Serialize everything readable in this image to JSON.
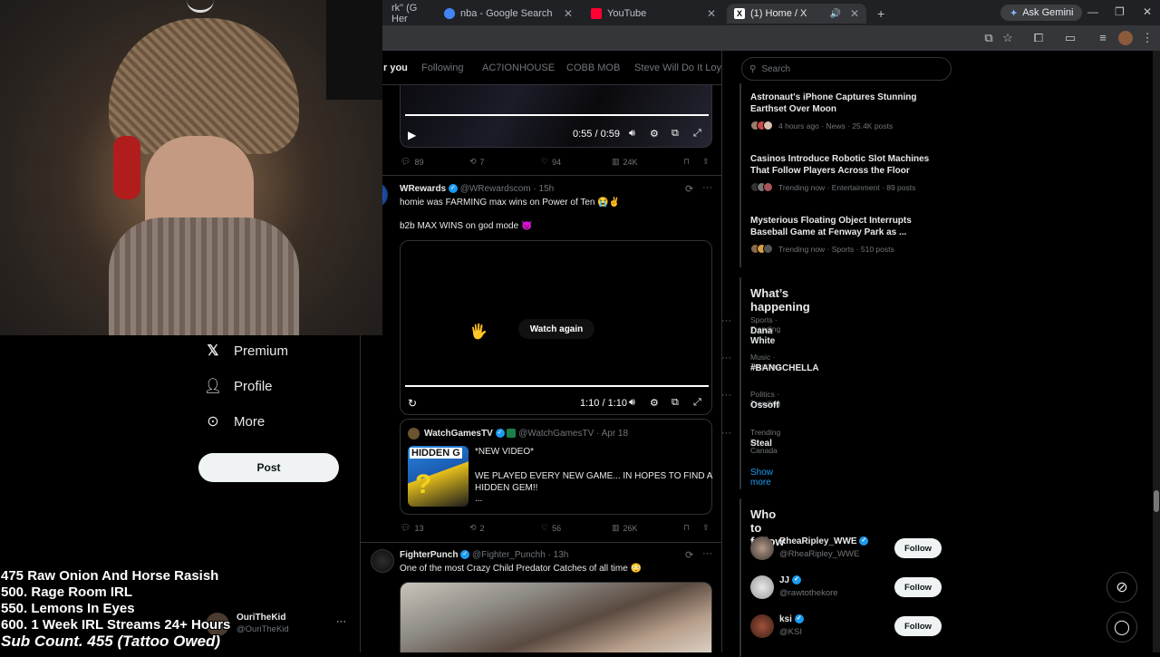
{
  "browser": {
    "tabs": [
      {
        "label": "rk\" (G Her",
        "favicon_color": "#5f6368"
      },
      {
        "label": "nba - Google Search",
        "favicon_color": "#4285f4"
      },
      {
        "label": "YouTube",
        "favicon_color": "#ff0033"
      },
      {
        "label": "(1) Home / X",
        "favicon_color": "#000000"
      }
    ],
    "new_tab": "+",
    "ask_gemini": "Ask Gemini"
  },
  "feed_tabs": [
    "r you",
    "Following",
    "AC7IONHOUSE",
    "COBB MOB",
    "Steve Will Do It Loyal"
  ],
  "nav": {
    "premium": "Premium",
    "profile": "Profile",
    "more": "More",
    "post": "Post"
  },
  "account": {
    "name": "OuriTheKid",
    "handle": "@OuriTheKid"
  },
  "stream_overlay": [
    "475 Raw Onion And Horse Rasish",
    "500. Rage Room IRL",
    "550. Lemons In Eyes",
    "600. 1 Week IRL Streams 24+ Hours",
    "Sub Count. 455 (Tattoo Owed)"
  ],
  "tweet1": {
    "video_time": "0:55 / 0:59",
    "replies": "89",
    "reposts": "7",
    "likes": "94",
    "views": "24K"
  },
  "tweet2": {
    "name": "WRewards",
    "handle": "@WRewardscom",
    "time": "· 15h",
    "line1": "homie was FARMING max wins on Power of Ten 😭✌️",
    "line2": "b2b MAX WINS on god mode 😈",
    "watch_again": "Watch again",
    "video_time": "1:10 / 1:10",
    "quote": {
      "name": "WatchGamesTV",
      "handle": "@WatchGamesTV",
      "time": "· Apr 18",
      "thumb_text": "HIDDEN G",
      "line1": "*NEW VIDEO*",
      "line2": "WE PLAYED EVERY NEW GAME... IN HOPES TO FIND A",
      "line3": "HIDDEN GEM!!",
      "line4": "..."
    },
    "replies": "13",
    "reposts": "2",
    "likes": "56",
    "views": "26K"
  },
  "tweet3": {
    "name": "FighterPunch",
    "handle": "@Fighter_Punchh",
    "time": "· 13h",
    "text": "One of the most Crazy Child Predator Catches of all time 😳"
  },
  "search": {
    "placeholder": "Search"
  },
  "news": [
    {
      "title": "Astronaut's iPhone Captures Stunning Earthset Over Moon",
      "meta": "4 hours ago · News · 25.4K posts"
    },
    {
      "title": "Casinos Introduce Robotic Slot Machines That Follow Players Across the Floor",
      "meta": "Trending now · Entertainment · 89 posts"
    },
    {
      "title": "Mysterious Floating Object Interrupts Baseball Game at Fenway Park as ...",
      "meta": "Trending now · Sports · 510 posts"
    }
  ],
  "whats_happening": {
    "title": "What’s happening",
    "trends": [
      {
        "category": "Sports · Trending",
        "name": "Dana White"
      },
      {
        "category": "Music · Trending",
        "name": "#BANGCHELLA"
      },
      {
        "category": "Politics · Trending",
        "name": "Ossoff"
      },
      {
        "category": "Trending in Canada",
        "name": "Steal"
      }
    ],
    "show_more": "Show more"
  },
  "who_to_follow": {
    "title": "Who to follow",
    "accounts": [
      {
        "name": "RheaRipley_WWE",
        "handle": "@RheaRipley_WWE",
        "button": "Follow"
      },
      {
        "name": "JJ",
        "handle": "@rawtothekore",
        "button": "Follow"
      },
      {
        "name": "ksi",
        "handle": "@KSI",
        "button": "Follow"
      }
    ]
  },
  "colors": {
    "accent": "#1d9bf0",
    "background": "#000000",
    "border": "#2f3336",
    "muted": "#71767b"
  }
}
